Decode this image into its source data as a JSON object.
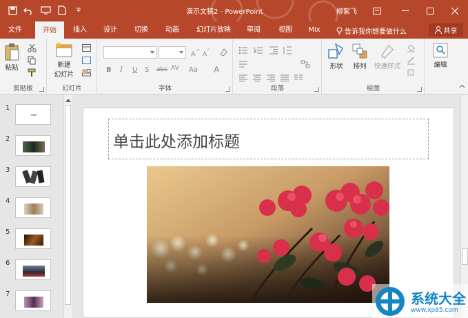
{
  "title_bar": {
    "document_title": "演示文稿2 - PowerPoint",
    "user": "柳絮飞"
  },
  "tabs": [
    {
      "label": "文件"
    },
    {
      "label": "开始",
      "active": true
    },
    {
      "label": "插入"
    },
    {
      "label": "设计"
    },
    {
      "label": "切换"
    },
    {
      "label": "动画"
    },
    {
      "label": "幻灯片放映"
    },
    {
      "label": "审阅"
    },
    {
      "label": "视图"
    },
    {
      "label": "Mix"
    }
  ],
  "tell_me": "告诉我你想要做什么",
  "share": "共享",
  "ribbon": {
    "clipboard": {
      "paste": "粘贴",
      "group": "剪贴板"
    },
    "slides": {
      "new_slide_line1": "新建",
      "new_slide_line2": "幻灯片",
      "group": "幻灯片"
    },
    "font": {
      "group": "字体"
    },
    "paragraph": {
      "group": "段落"
    },
    "drawing": {
      "shape": "形状",
      "arrange": "排列",
      "quick_styles": "快速样式",
      "group": "绘图"
    },
    "editing": {
      "label": "编辑"
    }
  },
  "slides": [
    {
      "number": "1"
    },
    {
      "number": "2"
    },
    {
      "number": "3"
    },
    {
      "number": "4"
    },
    {
      "number": "5"
    },
    {
      "number": "6"
    },
    {
      "number": "7"
    }
  ],
  "slide": {
    "title_placeholder": "单击此处添加标题"
  },
  "watermark": {
    "name": "系统大全",
    "url": "www.xp85.com"
  },
  "colors": {
    "accent": "#b7472a",
    "ribbon_bg": "#f3f3f3"
  }
}
